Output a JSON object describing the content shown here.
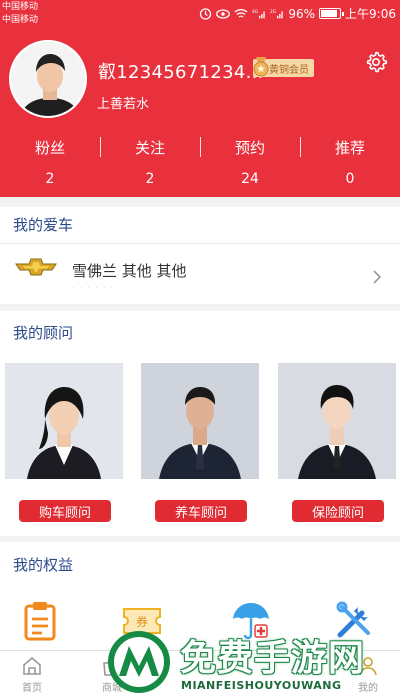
{
  "status_bar": {
    "carrier_1": "中国移动",
    "carrier_2": "中国移动",
    "signal_1": "4G",
    "signal_2": "2G",
    "battery_text": "96%",
    "battery_level": 0.96,
    "time": "上午9:06"
  },
  "profile": {
    "username": "叡12345671234...",
    "tagline": "上善若水",
    "badge": "黄铜会员",
    "settings_icon": "gear-icon"
  },
  "stats": [
    {
      "label": "粉丝",
      "value": "2"
    },
    {
      "label": "关注",
      "value": "2"
    },
    {
      "label": "预约",
      "value": "24"
    },
    {
      "label": "推荐",
      "value": "0"
    }
  ],
  "my_car": {
    "title": "我的爱车",
    "name": "雪佛兰 其他 其他",
    "sub": "· · · · · ·",
    "logo_icon": "chevrolet-logo-icon"
  },
  "advisors": {
    "title": "我的顾问",
    "items": [
      {
        "label": "购车顾问"
      },
      {
        "label": "养车顾问"
      },
      {
        "label": "保险顾问"
      }
    ]
  },
  "benefits": {
    "title": "我的权益",
    "icons": [
      "clipboard-icon",
      "coupon-icon",
      "insurance-umbrella-icon",
      "tools-icon"
    ],
    "coupon_text": "券"
  },
  "tabbar": {
    "tabs": [
      {
        "label": "首页",
        "icon": "home-icon"
      },
      {
        "label": "商城",
        "icon": "shop-icon"
      },
      {
        "label": "我的",
        "icon": "user-icon"
      }
    ]
  },
  "watermark": {
    "title": "免费手游网",
    "subtitle": "MIANFEISHOUYOUWANG"
  },
  "colors": {
    "brand_red": "#e8313d",
    "section_title": "#2b4a8c",
    "badge_bg": "#f6d7a6"
  }
}
